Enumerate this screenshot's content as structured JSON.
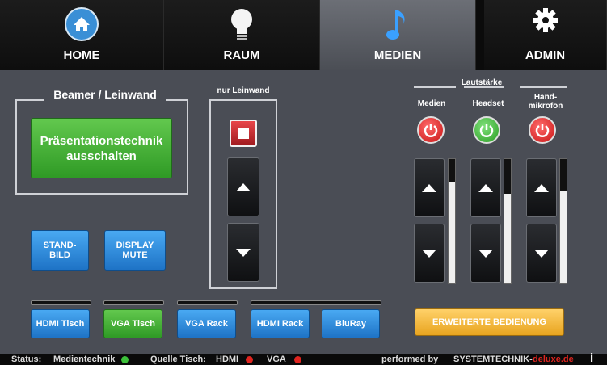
{
  "nav": {
    "tabs": [
      {
        "label": "HOME",
        "icon": "home-icon"
      },
      {
        "label": "RAUM",
        "icon": "lightbulb-icon"
      },
      {
        "label": "MEDIEN",
        "icon": "music-note-icon",
        "active": true
      },
      {
        "label": "ADMIN",
        "icon": "gear-icon"
      }
    ]
  },
  "beamer": {
    "title": "Beamer / Leinwand",
    "off_button": "Präsentationstechnik ausschalten"
  },
  "leinwand": {
    "title": "nur Leinwand"
  },
  "display": {
    "standbild": "STAND- BILD",
    "mute": "DISPLAY MUTE"
  },
  "sources": [
    {
      "label": "HDMI Tisch",
      "active": false
    },
    {
      "label": "VGA Tisch",
      "active": true
    },
    {
      "label": "VGA Rack",
      "active": false
    },
    {
      "label": "HDMI Rack",
      "active": false
    },
    {
      "label": "BluRay",
      "active": false
    }
  ],
  "volume": {
    "title": "Lautstärke",
    "channels": [
      {
        "label": "Medien",
        "power": "off",
        "level": 0.82
      },
      {
        "label": "Headset",
        "power": "on",
        "level": 0.72
      },
      {
        "label": "Hand- mikrofon",
        "power": "off",
        "level": 0.75
      }
    ]
  },
  "extended_button": "ERWEITERTE BEDIENUNG",
  "status": {
    "status_label": "Status:",
    "medientechnik": "Medientechnik",
    "quelle_label": "Quelle Tisch:",
    "hdmi": "HDMI",
    "vga": "VGA",
    "performed_by": "performed by",
    "brand": "SYSTEMTECHNIK-",
    "brand_suffix": "deluxe.de",
    "info": "i"
  },
  "colors": {
    "panel": "#4a4d55",
    "green_status": "#3cc13a",
    "red_status": "#e0241f",
    "brand_red": "#e0241f"
  }
}
